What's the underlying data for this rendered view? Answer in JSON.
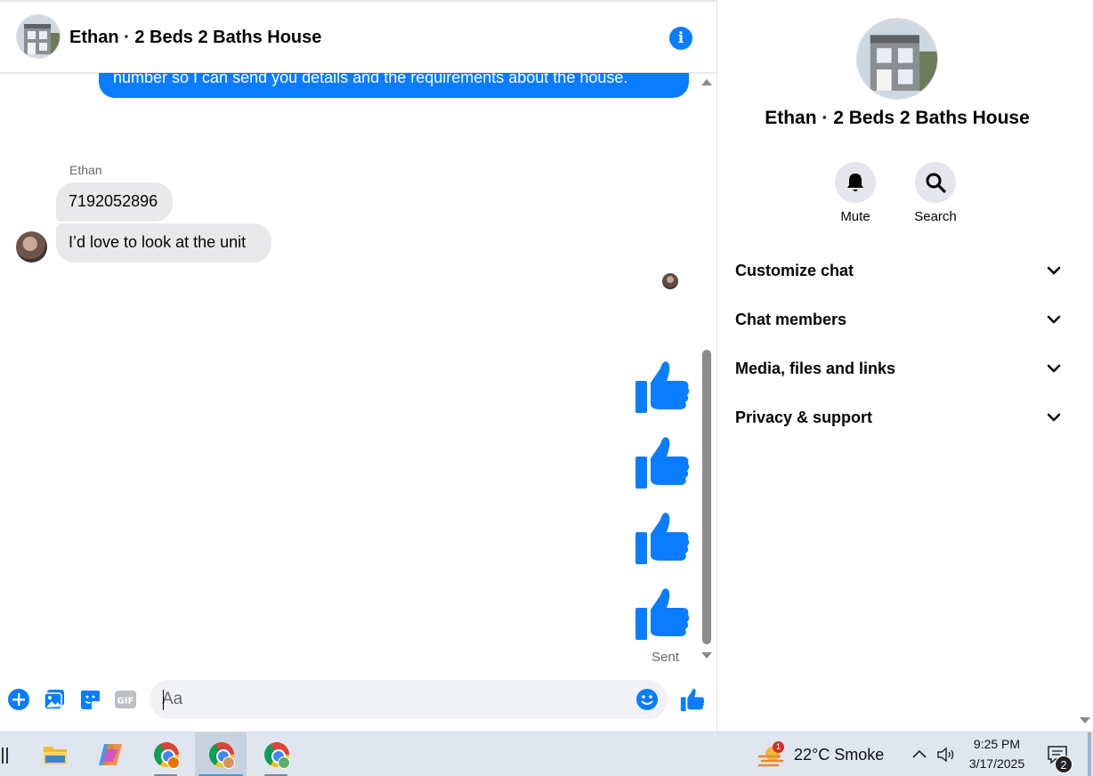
{
  "chat": {
    "title": "Ethan · 2 Beds 2 Baths House",
    "outgoing_partial": "number so I can send you details and the requirements about the house.",
    "sender_name": "Ethan",
    "incoming": [
      "7192052896",
      "I’d love to look at the unit"
    ],
    "status": "Sent",
    "composer_placeholder": "Aa"
  },
  "panel": {
    "title": "Ethan · 2 Beds 2 Baths House",
    "actions": [
      {
        "label": "Mute",
        "icon": "bell-icon"
      },
      {
        "label": "Search",
        "icon": "search-icon"
      }
    ],
    "sections": [
      "Customize chat",
      "Chat members",
      "Media, files and links",
      "Privacy & support"
    ]
  },
  "taskbar": {
    "weather": "22°C  Smoke",
    "weather_alerts": "1",
    "time": "9:25 PM",
    "date": "3/17/2025",
    "notifications": "2"
  },
  "colors": {
    "accent": "#0a7cff",
    "bubble_in": "#e9e9eb"
  }
}
